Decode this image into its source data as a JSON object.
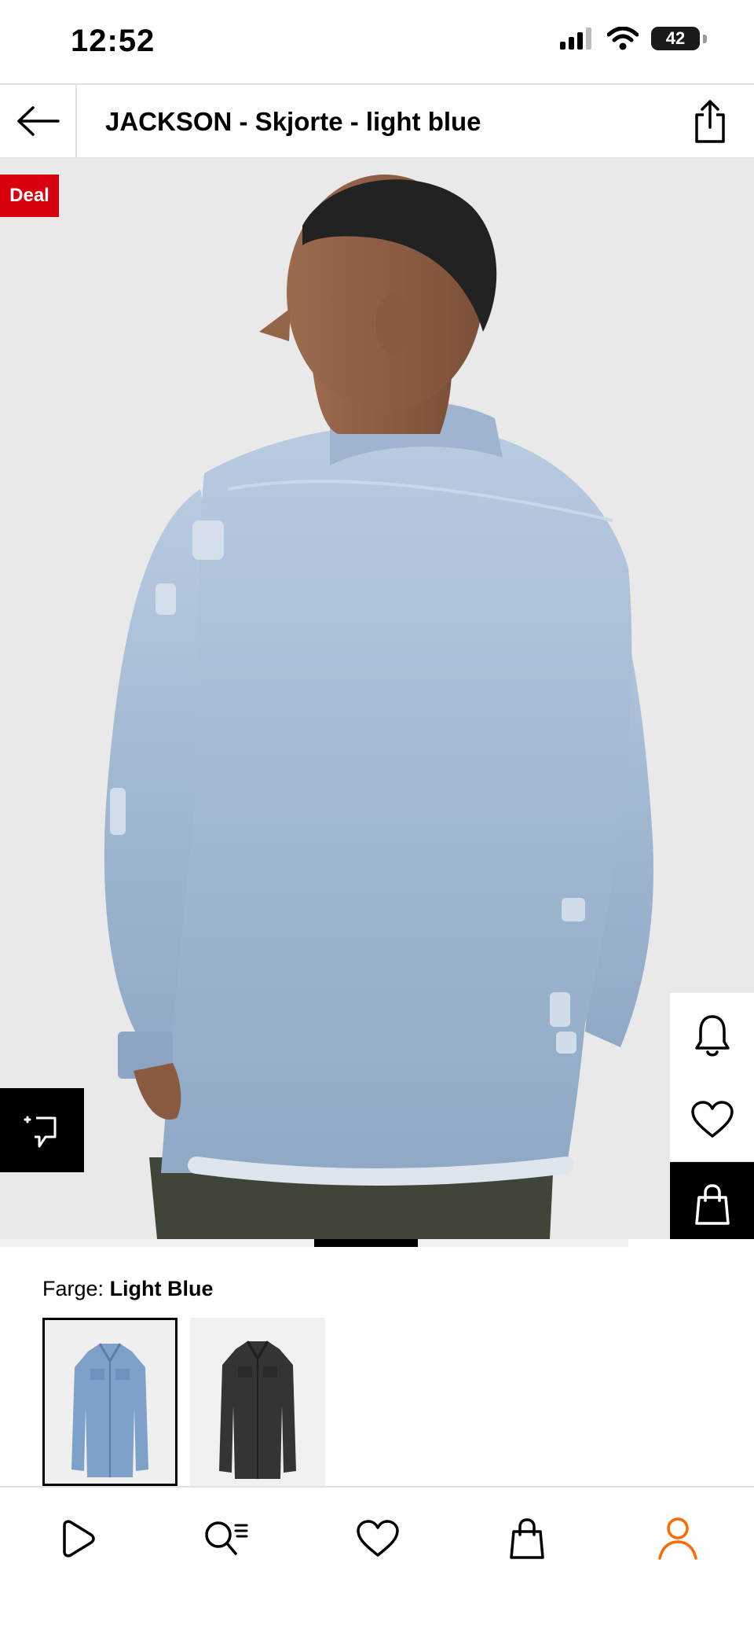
{
  "status": {
    "time": "12:52",
    "battery": "42"
  },
  "header": {
    "title": "JACKSON - Skjorte - light blue"
  },
  "product": {
    "badge": "Deal"
  },
  "color": {
    "label": "Farge:",
    "value": "Light Blue",
    "swatches": [
      "Light Blue",
      "Black"
    ]
  },
  "icons": {
    "back": "arrow-left-icon",
    "share": "share-icon",
    "ar": "augmented-reality-icon",
    "notify": "bell-icon",
    "wishlist": "heart-icon",
    "cart": "shopping-bag-icon"
  },
  "nav": {
    "items": [
      "play-icon",
      "search-list-icon",
      "heart-icon",
      "shopping-bag-icon",
      "profile-icon"
    ],
    "active": "profile-icon"
  },
  "colors": {
    "deal_red": "#d8000e",
    "nav_active": "#ff6900",
    "denim_light": "#a8bfd7",
    "denim_dark": "#3b3b3d"
  }
}
